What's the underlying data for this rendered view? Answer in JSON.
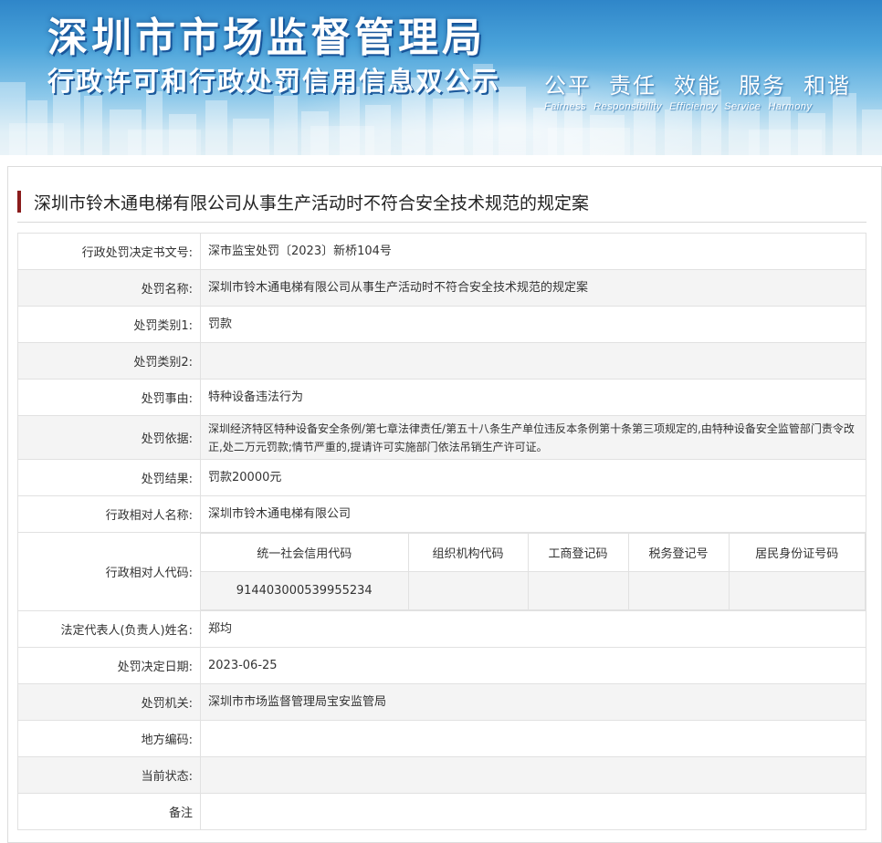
{
  "banner": {
    "title": "深圳市市场监督管理局",
    "subtitle": "行政许可和行政处罚信用信息双公示",
    "motto_cn": [
      "公平",
      "责任",
      "效能",
      "服务",
      "和谐"
    ],
    "motto_en": [
      "Fairness",
      "Responsibility",
      "Efficiency",
      "Service",
      "Harmony"
    ]
  },
  "case_title": "深圳市铃木通电梯有限公司从事生产活动时不符合安全技术规范的规定案",
  "fields": {
    "decision_no": {
      "label": "行政处罚决定书文号:",
      "value": "深市监宝处罚〔2023〕新桥104号"
    },
    "penalty_name": {
      "label": "处罚名称:",
      "value": "深圳市铃木通电梯有限公司从事生产活动时不符合安全技术规范的规定案"
    },
    "category1": {
      "label": "处罚类别1:",
      "value": "罚款"
    },
    "category2": {
      "label": "处罚类别2:",
      "value": ""
    },
    "cause": {
      "label": "处罚事由:",
      "value": "特种设备违法行为"
    },
    "basis": {
      "label": "处罚依据:",
      "value": "深圳经济特区特种设备安全条例/第七章法律责任/第五十八条生产单位违反本条例第十条第三项规定的,由特种设备安全监管部门责令改正,处二万元罚款;情节严重的,提请许可实施部门依法吊销生产许可证。"
    },
    "result": {
      "label": "处罚结果:",
      "value": "罚款20000元"
    },
    "party_name": {
      "label": "行政相对人名称:",
      "value": "深圳市铃木通电梯有限公司"
    },
    "party_code": {
      "label": "行政相对人代码:",
      "headers": [
        "统一社会信用代码",
        "组织机构代码",
        "工商登记码",
        "税务登记号",
        "居民身份证号码"
      ],
      "values": [
        "914403000539955234",
        "",
        "",
        "",
        ""
      ]
    },
    "legal_rep": {
      "label": "法定代表人(负责人)姓名:",
      "value": "郑均"
    },
    "decision_date": {
      "label": "处罚决定日期:",
      "value": "2023-06-25"
    },
    "authority": {
      "label": "处罚机关:",
      "value": "深圳市市场监督管理局宝安监管局"
    },
    "region_code": {
      "label": "地方编码:",
      "value": ""
    },
    "status": {
      "label": "当前状态:",
      "value": ""
    },
    "remark": {
      "label": "备注",
      "value": ""
    }
  }
}
